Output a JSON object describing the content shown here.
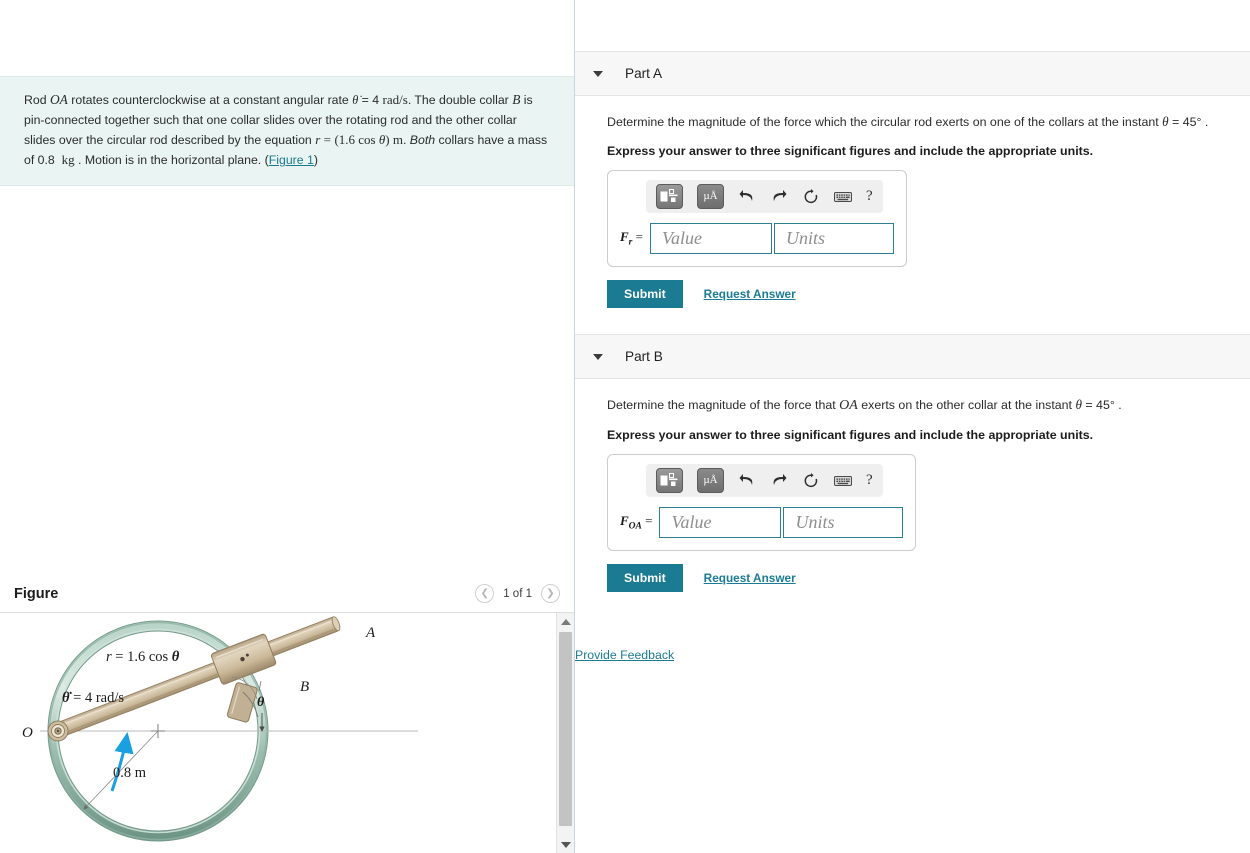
{
  "problem": {
    "text_segments": [
      {
        "t": "Rod ",
        "k": "plain"
      },
      {
        "t": "OA",
        "k": "mathvar"
      },
      {
        "t": " rotates counterclockwise at a constant angular rate ",
        "k": "plain"
      },
      {
        "t": "θ̇",
        "k": "mathvar"
      },
      {
        "t": " = 4 ",
        "k": "plain"
      },
      {
        "t": "rad/s",
        "k": "mathrm"
      },
      {
        "t": ". The double collar ",
        "k": "plain"
      },
      {
        "t": "B",
        "k": "mathvar"
      },
      {
        "t": " is pin-connected together such that one collar slides over the rotating rod and the other collar slides over the circular rod described by the equation ",
        "k": "plain"
      },
      {
        "t": "r = (1.6 cos θ) m",
        "k": "mathrm"
      },
      {
        "t": ". Both collars have a mass of 0.8 ",
        "k": "italic-both"
      },
      {
        "t": "kg",
        "k": "mathrm"
      },
      {
        "t": " . Motion is in the horizontal plane. ",
        "k": "plain"
      }
    ],
    "plain_text": "Rod OA rotates counterclockwise at a constant angular rate θ̇ = 4 rad/s. The double collar B is pin-connected together such that one collar slides over the rotating rod and the other collar slides over the circular rod described by the equation r = (1.6 cos θ) m. Both collars have a mass of 0.8 kg . Motion is in the horizontal plane.",
    "figure_link_label": "Figure 1",
    "background_color": "#e9f4f3"
  },
  "figure": {
    "title": "Figure",
    "nav": {
      "prev_icon": "chevron-left-icon",
      "next_icon": "chevron-right-icon",
      "counter": "1 of 1"
    },
    "labels": {
      "origin": "O",
      "point_a": "A",
      "collar_b": "B",
      "equation_r": "r = 1.6 cos θ",
      "omega": "θ̇ = 4 rad/s",
      "theta": "θ",
      "radius": "0.8 m"
    },
    "colors": {
      "ring": "#9ec0b3",
      "ring_dark": "#6f9786",
      "ring_light": "#cfe2da",
      "rod": "#cfbfa2",
      "rod_dark": "#a08d6d",
      "arrow_blue": "#1a9fe0"
    },
    "scrollbar": {
      "up_icon": "triangle-up-icon",
      "down_icon": "triangle-down-icon"
    }
  },
  "toolbar_common": {
    "template_icon": "math-template-icon",
    "units_label": "µÅ",
    "units_icon": "units-icon",
    "undo_icon": "undo-icon",
    "redo_icon": "redo-icon",
    "reset_icon": "reset-icon",
    "keyboard_icon": "keyboard-icon",
    "help_label": "?"
  },
  "parts": [
    {
      "header": "Part A",
      "question_prefix": "Determine the magnitude of the force which the circular rod exerts on one of the collars at the instant ",
      "question_theta": "θ",
      "question_suffix": " = 45° .",
      "instruction": "Express your answer to three significant figures and include the appropriate units.",
      "var_base": "F",
      "var_sub": "r",
      "equals": " =",
      "value_placeholder": "Value",
      "units_placeholder": "Units",
      "value_current": "",
      "units_current": "",
      "submit_label": "Submit",
      "request_label": "Request Answer"
    },
    {
      "header": "Part B",
      "question_prefix": "Determine the magnitude of the force that ",
      "question_var": "OA",
      "question_mid": " exerts on the other collar at the instant ",
      "question_theta": "θ",
      "question_suffix": " = 45° .",
      "instruction": "Express your answer to three significant figures and include the appropriate units.",
      "var_base": "F",
      "var_sub": "OA",
      "equals": " =",
      "value_placeholder": "Value",
      "units_placeholder": "Units",
      "value_current": "",
      "units_current": "",
      "submit_label": "Submit",
      "request_label": "Request Answer"
    }
  ],
  "footer": {
    "feedback_label": "Provide Feedback"
  },
  "theme": {
    "accent": "#1b7b92",
    "link": "#1b7b92",
    "part_header_bg": "#f7f7f7",
    "field_border": "#2b7f90"
  }
}
